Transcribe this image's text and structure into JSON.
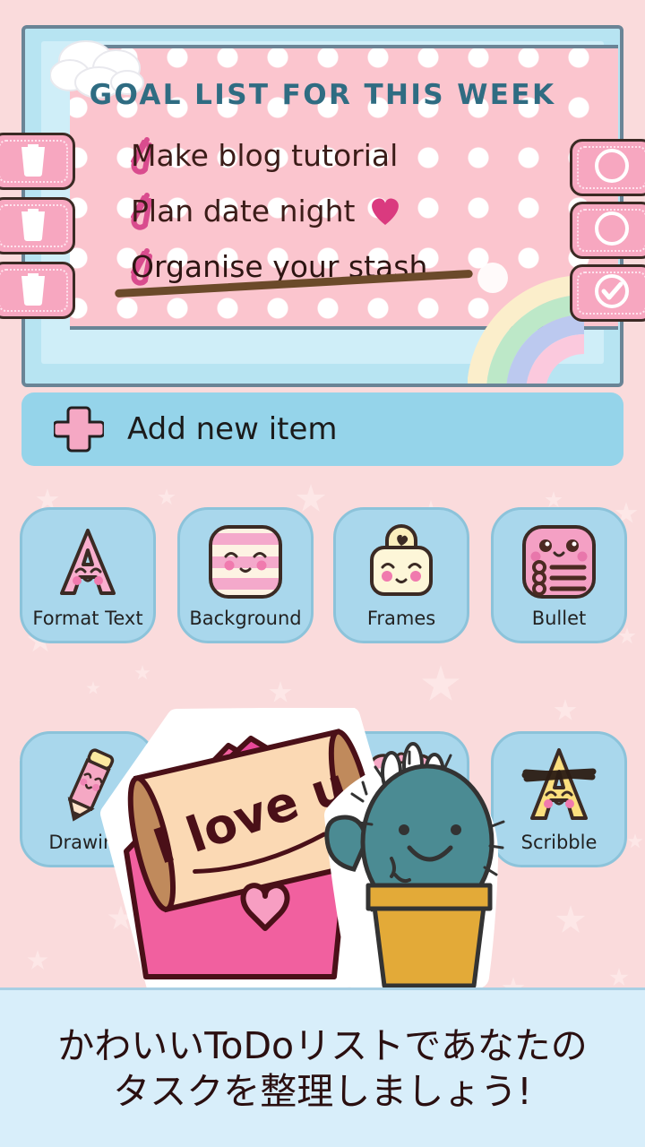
{
  "app": {
    "background_color": "#fadbdc",
    "accent_pink": "#f7a7c0",
    "accent_blue": "#95d4ea",
    "title_color": "#2f6c82"
  },
  "list_card": {
    "title": "GOAL LIST FOR THIS WEEK",
    "items": [
      {
        "text": "Make blog tutorial",
        "bullet_icon": "paperclip-icon",
        "done": false,
        "has_heart": false,
        "delete_icon": "trash-icon",
        "check_icon": "circle-empty-icon"
      },
      {
        "text": "Plan date night",
        "bullet_icon": "paperclip-icon",
        "done": false,
        "has_heart": true,
        "delete_icon": "trash-icon",
        "check_icon": "circle-empty-icon"
      },
      {
        "text": "Organise your stash",
        "bullet_icon": "paperclip-icon",
        "done": true,
        "has_heart": false,
        "delete_icon": "trash-icon",
        "check_icon": "circle-check-icon"
      }
    ],
    "decorations": [
      "cloud-icon",
      "rainbow-icon",
      "polka-dot-pattern"
    ]
  },
  "add_row": {
    "label": "Add new item",
    "icon": "plus-icon"
  },
  "tools": [
    {
      "label": "Format Text",
      "icon": "kawaii-letter-a-pink-icon"
    },
    {
      "label": "Background",
      "icon": "kawaii-striped-square-icon"
    },
    {
      "label": "Frames",
      "icon": "kawaii-frame-heart-icon"
    },
    {
      "label": "Bullet",
      "icon": "kawaii-bullet-list-icon"
    },
    {
      "label": "Drawing",
      "icon": "kawaii-pencil-icon"
    },
    {
      "label": "",
      "icon": "hidden-behind-sticker-icon"
    },
    {
      "label": "",
      "icon": "kawaii-alarm-clock-icon"
    },
    {
      "label": "Scribble",
      "icon": "kawaii-letter-a-yellow-scribble-icon"
    }
  ],
  "stickers": [
    {
      "name": "love-letter-sticker",
      "text": "I love u"
    },
    {
      "name": "cactus-sticker",
      "text": ""
    }
  ],
  "caption": {
    "line1": "かわいいToDoリストであなたの",
    "line2": "タスクを整理しましょう!"
  }
}
